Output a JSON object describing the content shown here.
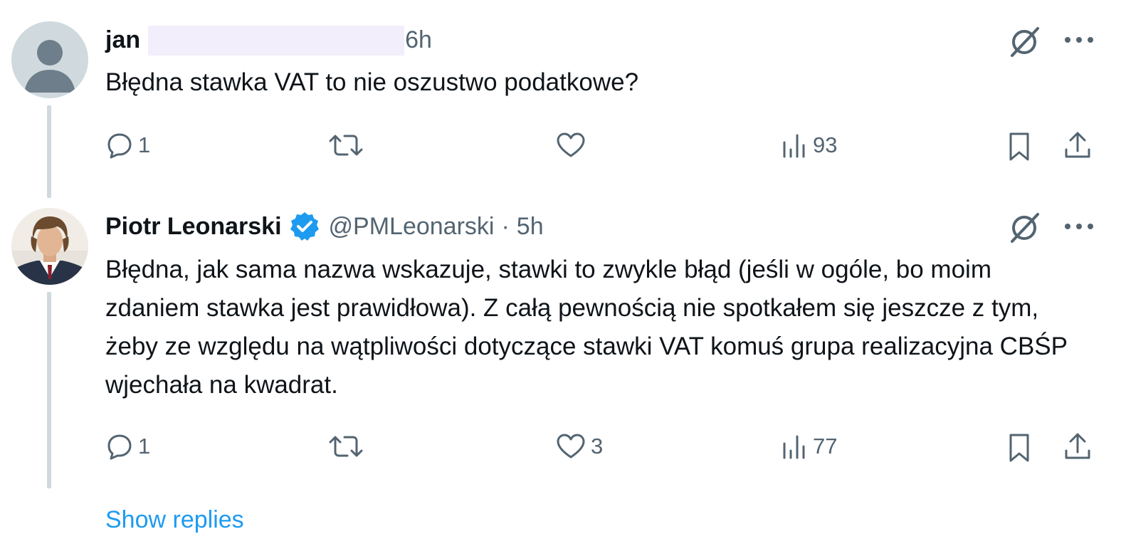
{
  "thread": {
    "show_replies_label": "Show replies",
    "tweets": [
      {
        "name": "jan",
        "handle": "",
        "time": "6h",
        "text": "Błędna stawka VAT to nie oszustwo podatkowe?",
        "actions": {
          "replies": "1",
          "reposts": "",
          "likes": "",
          "views": "93"
        }
      },
      {
        "name": "Piotr Leonarski",
        "verified": true,
        "handle": "@PMLeonarski",
        "separator": "·",
        "time": "5h",
        "text": "Błędna, jak sama nazwa wskazuje, stawki to zwykle błąd (jeśli w ogóle, bo moim zdaniem stawka jest prawidłowa). Z całą pewnością nie spotkałem się jeszcze z tym, żeby ze względu na wątpliwości dotyczące stawki VAT komuś grupa realizacyjna CBŚP wjechała na kwadrat.",
        "actions": {
          "replies": "1",
          "reposts": "",
          "likes": "3",
          "views": "77"
        }
      }
    ]
  },
  "colors": {
    "text_primary": "#0f1419",
    "text_secondary": "#536471",
    "accent": "#1d9bf0",
    "thread_line": "#cfd9de"
  },
  "icons": {
    "reply": "reply-icon",
    "repost": "repost-icon",
    "like": "like-icon",
    "views": "views-icon",
    "bookmark": "bookmark-icon",
    "share": "share-icon",
    "grok": "grok-icon",
    "more": "more-icon",
    "verified": "verified-badge-icon"
  }
}
